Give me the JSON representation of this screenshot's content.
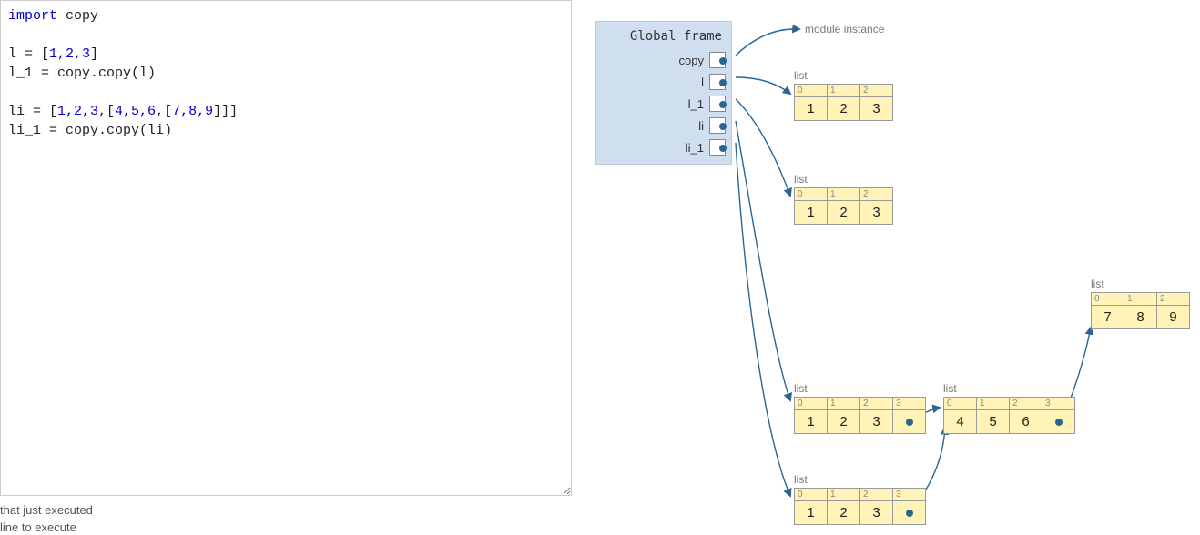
{
  "code": {
    "line1_kw": "import",
    "line1_mod": " copy",
    "line3": "l = [",
    "line3_nums": "1,2,3",
    "line3_end": "]",
    "line4": "l_1 = copy.copy(l)",
    "line6a": "li = [",
    "line6b": "1,2,3",
    "line6c": ",[",
    "line6d": "4,5,6",
    "line6e": ",[",
    "line6f": "7,8,9",
    "line6g": "]]]",
    "line7": "li_1 = copy.copy(li)"
  },
  "footer": {
    "executed": "that just executed",
    "next": "line to execute"
  },
  "frame": {
    "title": "Global frame",
    "vars": [
      "copy",
      "l",
      "l_1",
      "li",
      "li_1"
    ]
  },
  "objects": {
    "module": "module instance",
    "list_label": "list",
    "list_l": {
      "idx": [
        "0",
        "1",
        "2"
      ],
      "val": [
        "1",
        "2",
        "3"
      ]
    },
    "list_l1": {
      "idx": [
        "0",
        "1",
        "2"
      ],
      "val": [
        "1",
        "2",
        "3"
      ]
    },
    "list_li": {
      "idx": [
        "0",
        "1",
        "2",
        "3"
      ],
      "val": [
        "1",
        "2",
        "3",
        ""
      ]
    },
    "list_inner1": {
      "idx": [
        "0",
        "1",
        "2",
        "3"
      ],
      "val": [
        "4",
        "5",
        "6",
        ""
      ]
    },
    "list_inner2": {
      "idx": [
        "0",
        "1",
        "2"
      ],
      "val": [
        "7",
        "8",
        "9"
      ]
    },
    "list_li1": {
      "idx": [
        "0",
        "1",
        "2",
        "3"
      ],
      "val": [
        "1",
        "2",
        "3",
        ""
      ]
    }
  }
}
